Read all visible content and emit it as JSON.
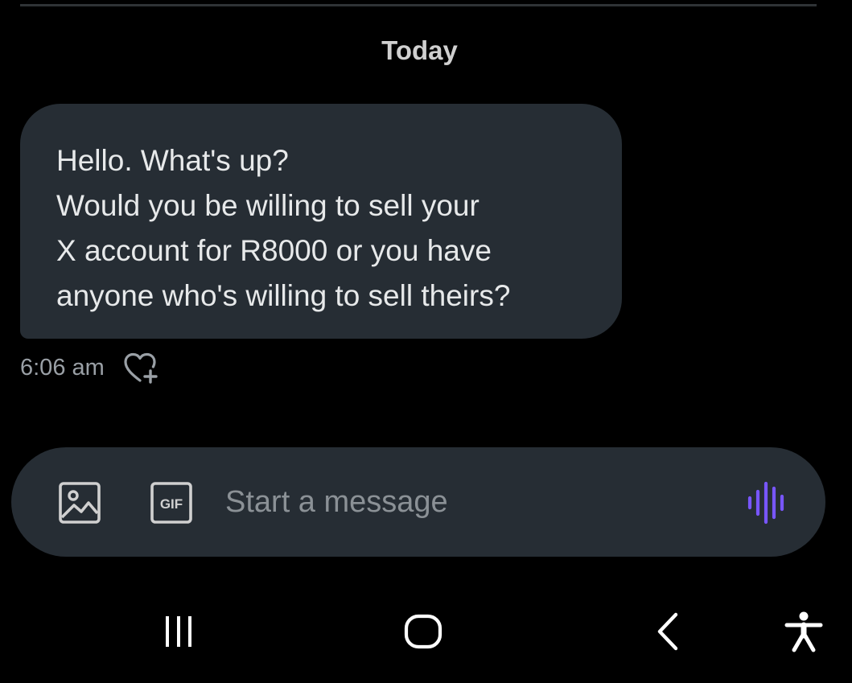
{
  "conversation": {
    "date_label": "Today",
    "messages": [
      {
        "lines": [
          "Hello. What's up?",
          "Would you be willing to sell your",
          "X account for R8000 or you have",
          "anyone who's willing to sell theirs?"
        ],
        "timestamp": "6:06 am",
        "react_icon": "heart-plus-icon"
      }
    ]
  },
  "composer": {
    "placeholder": "Start a message",
    "value": "",
    "media_icon": "image-icon",
    "gif_icon": "gif-icon",
    "gif_label": "GIF",
    "voice_icon": "voice-waveform-icon"
  },
  "system_nav": {
    "recents_icon": "recent-apps-icon",
    "home_icon": "home-icon",
    "back_icon": "back-icon",
    "accessibility_icon": "accessibility-icon"
  },
  "colors": {
    "background": "#000000",
    "bubble": "#262d34",
    "text_primary": "#e7e9ea",
    "text_secondary": "#9aa0a6",
    "accent_voice": "#7856ff"
  }
}
